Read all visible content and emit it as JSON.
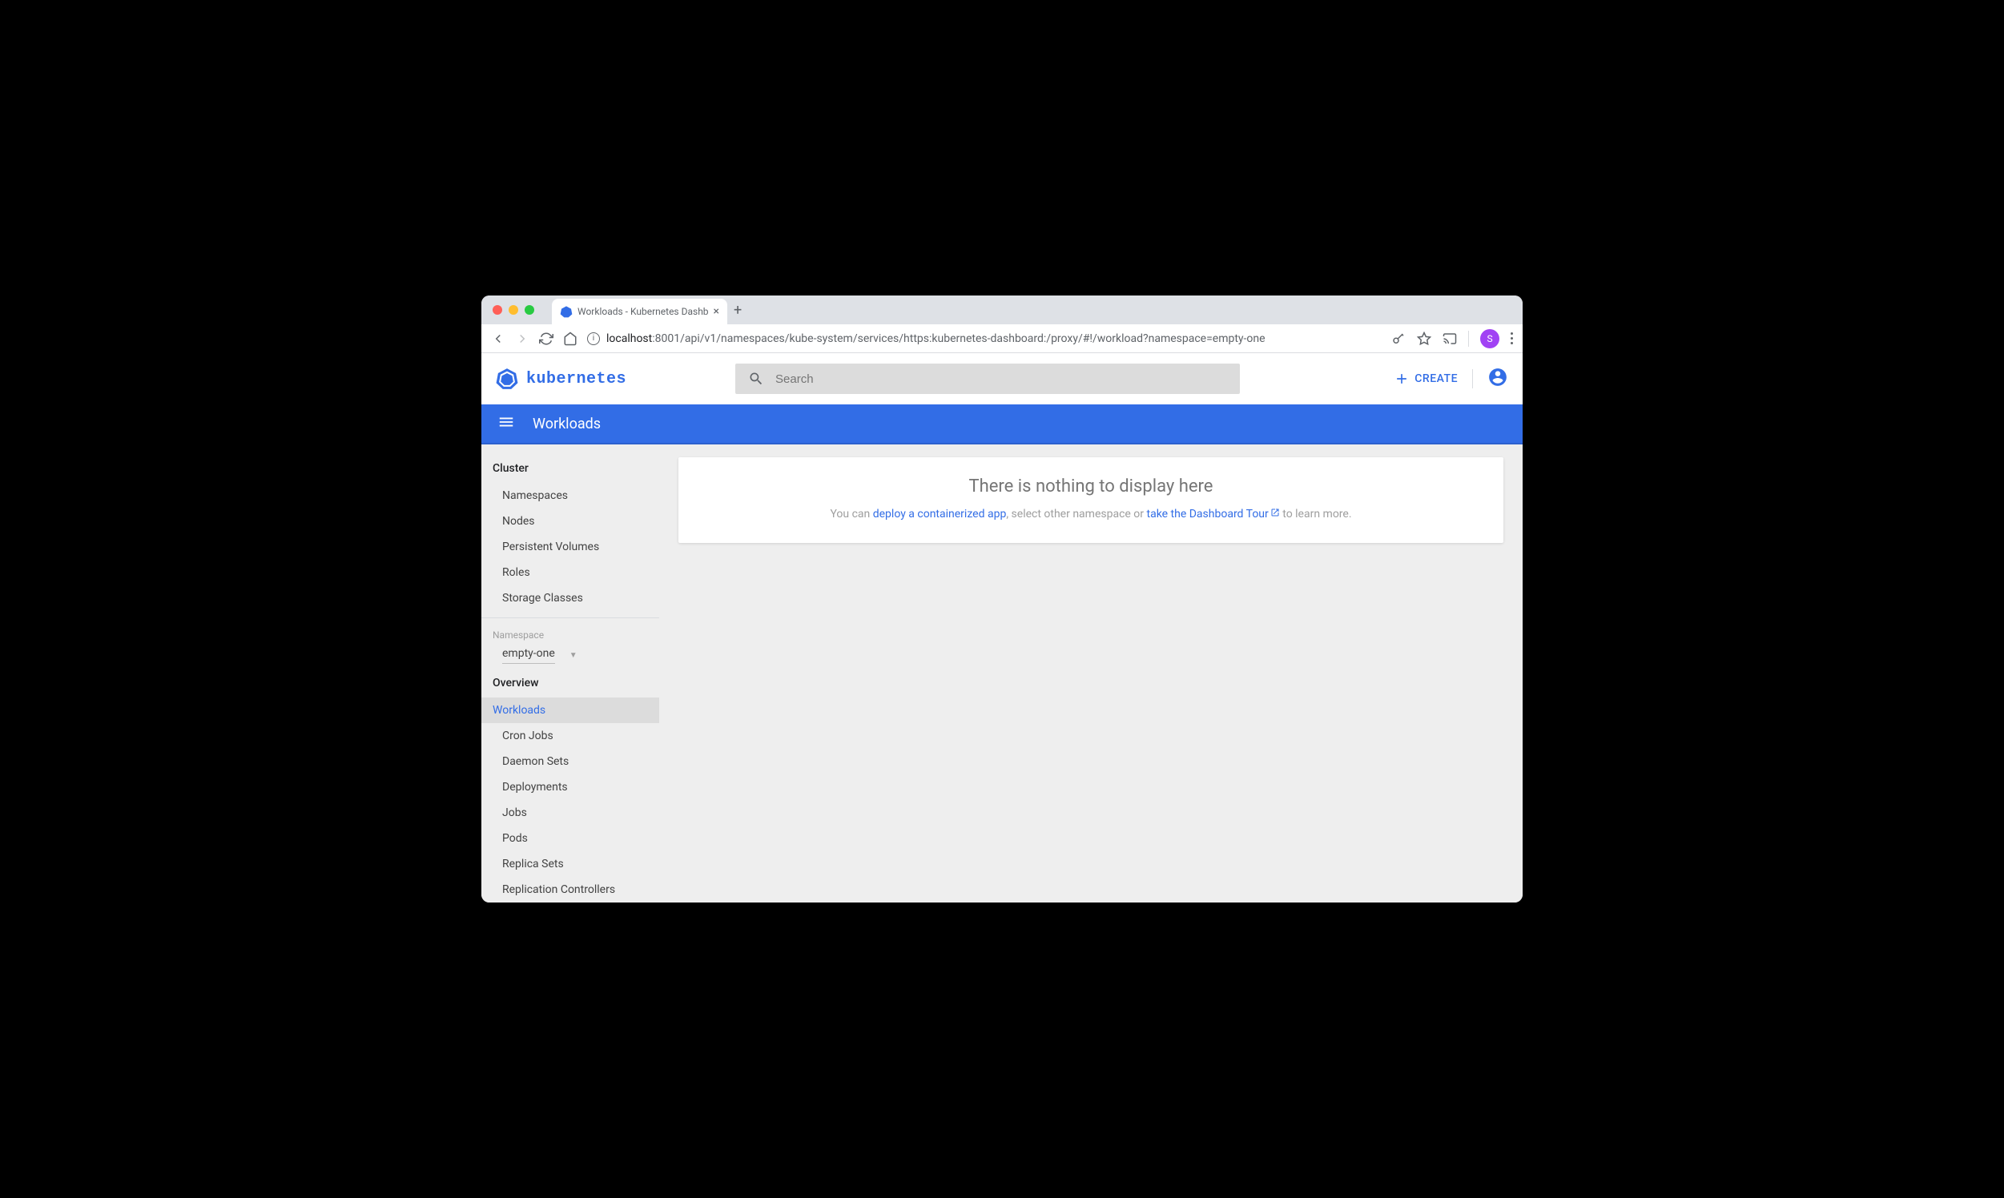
{
  "browser": {
    "tab_title": "Workloads - Kubernetes Dashb",
    "url_host": "localhost",
    "url_port": ":8001",
    "url_path": "/api/v1/namespaces/kube-system/services/https:kubernetes-dashboard:/proxy/#!/workload?namespace=empty-one",
    "user_initial": "S"
  },
  "header": {
    "logo_text": "kubernetes",
    "search_placeholder": "Search",
    "create_label": "CREATE"
  },
  "blue_bar": {
    "title": "Workloads"
  },
  "sidebar": {
    "cluster_header": "Cluster",
    "cluster_items": [
      "Namespaces",
      "Nodes",
      "Persistent Volumes",
      "Roles",
      "Storage Classes"
    ],
    "namespace_label": "Namespace",
    "namespace_value": "empty-one",
    "overview_header": "Overview",
    "workloads_label": "Workloads",
    "workload_items": [
      "Cron Jobs",
      "Daemon Sets",
      "Deployments",
      "Jobs",
      "Pods",
      "Replica Sets",
      "Replication Controllers"
    ]
  },
  "empty": {
    "title": "There is nothing to display here",
    "pre_text": "You can ",
    "link1": "deploy a containerized app",
    "mid_text": ", select other namespace or ",
    "link2": "take the Dashboard Tour",
    "post_text": " to learn more."
  }
}
